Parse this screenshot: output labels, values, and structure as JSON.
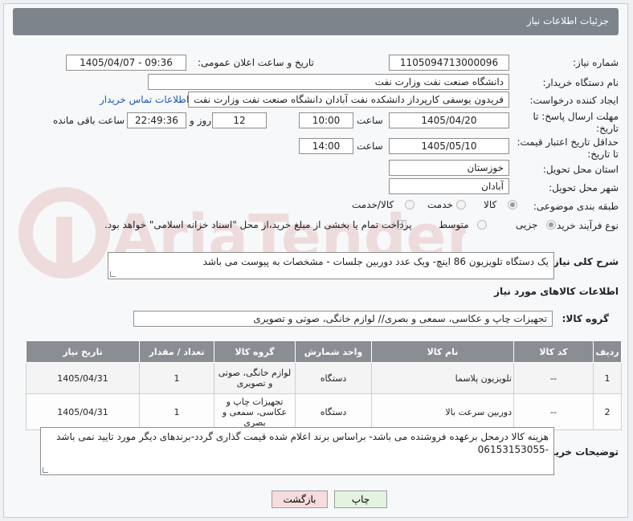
{
  "header": {
    "title": "جزئیات اطلاعات نیاز"
  },
  "labels": {
    "need_number": "شماره نیاز:",
    "announce_datetime": "تاریخ و ساعت اعلان عمومی:",
    "buyer_org": "نام دستگاه خریدار:",
    "requester": "ایجاد کننده درخواست:",
    "reply_deadline": "مهلت ارسال پاسخ: تا تاریخ:",
    "hour": "ساعت",
    "day_and": "روز و",
    "remaining": "ساعت باقی مانده",
    "price_validity": "حداقل تاریخ اعتبار قیمت: تا تاریخ:",
    "province": "استان محل تحویل:",
    "city": "شهر محل تحویل:",
    "category": "طبقه بندی موضوعی:",
    "process_type": "نوع فرآیند خرید :",
    "description": "شرح کلی نیاز:",
    "goods_info": "اطلاعات کالاهای مورد نیاز",
    "goods_group": "گروه کالا:",
    "buyer_notes": "توضیحات خریدار:"
  },
  "values": {
    "need_number": "1105094713000096",
    "announce_datetime": "1405/04/07 - 09:36",
    "buyer_org": "دانشگاه صنعت نفت وزارت نفت",
    "requester": "فریدون یوسفی کارپرداز دانشکده نفت آبادان دانشگاه صنعت نفت وزارت نفت",
    "contact_link": "اطلاعات تماس خریدار",
    "reply_date": "1405/04/20",
    "reply_time": "10:00",
    "days_left": "12",
    "time_left": "22:49:36",
    "validity_date": "1405/05/10",
    "validity_time": "14:00",
    "province": "خوزستان",
    "city": "آبادان",
    "description": "یک دستگاه تلویزیون 86 اینچ- ویک عدد دوربین جلسات - مشخصات به پیوست می باشد",
    "goods_group": "تجهیزات چاپ و عکاسی، سمعی و بصری// لوازم خانگی، صوتی و تصویری",
    "buyer_notes": "هزینه کالا درمحل برعهده فروشنده می باشد- براساس برند اعلام شده قیمت گذاری گردد-برندهای دیگر مورد تایید نمی باشد -06153153055"
  },
  "category_options": [
    {
      "label": "کالا",
      "selected": true
    },
    {
      "label": "خدمت",
      "selected": false
    },
    {
      "label": "کالا/خدمت",
      "selected": false
    }
  ],
  "process_options": [
    {
      "label": "جزیی",
      "selected": true
    },
    {
      "label": "متوسط",
      "selected": false
    }
  ],
  "payment_note": "پرداخت تمام یا بخشی از مبلغ خرید،از محل \"اسناد خزانه اسلامی\" خواهد بود.",
  "watermark_text": "AriaTender.neT",
  "table": {
    "headers": [
      "ردیف",
      "کد کالا",
      "نام کالا",
      "واحد شمارش",
      "گروه کالا",
      "تعداد / مقدار",
      "تاریخ نیاز"
    ],
    "rows": [
      [
        "1",
        "--",
        "تلویزیون پلاسما",
        "دستگاه",
        "لوازم خانگی، صوتی و تصویری",
        "1",
        "1405/04/31"
      ],
      [
        "2",
        "--",
        "دوربین سرعت بالا",
        "دستگاه",
        "تجهیزات چاپ و عکاسی، سمعی و بصری",
        "1",
        "1405/04/31"
      ]
    ]
  },
  "buttons": {
    "print": "چاپ",
    "back": "بازگشت"
  },
  "colors": {
    "header_bg": "#7d848c",
    "table_header_bg": "#8a8e93",
    "back_button_bg": "#f6dcdc",
    "print_button_bg": "#e3f3e0",
    "link": "#1c58b8"
  }
}
